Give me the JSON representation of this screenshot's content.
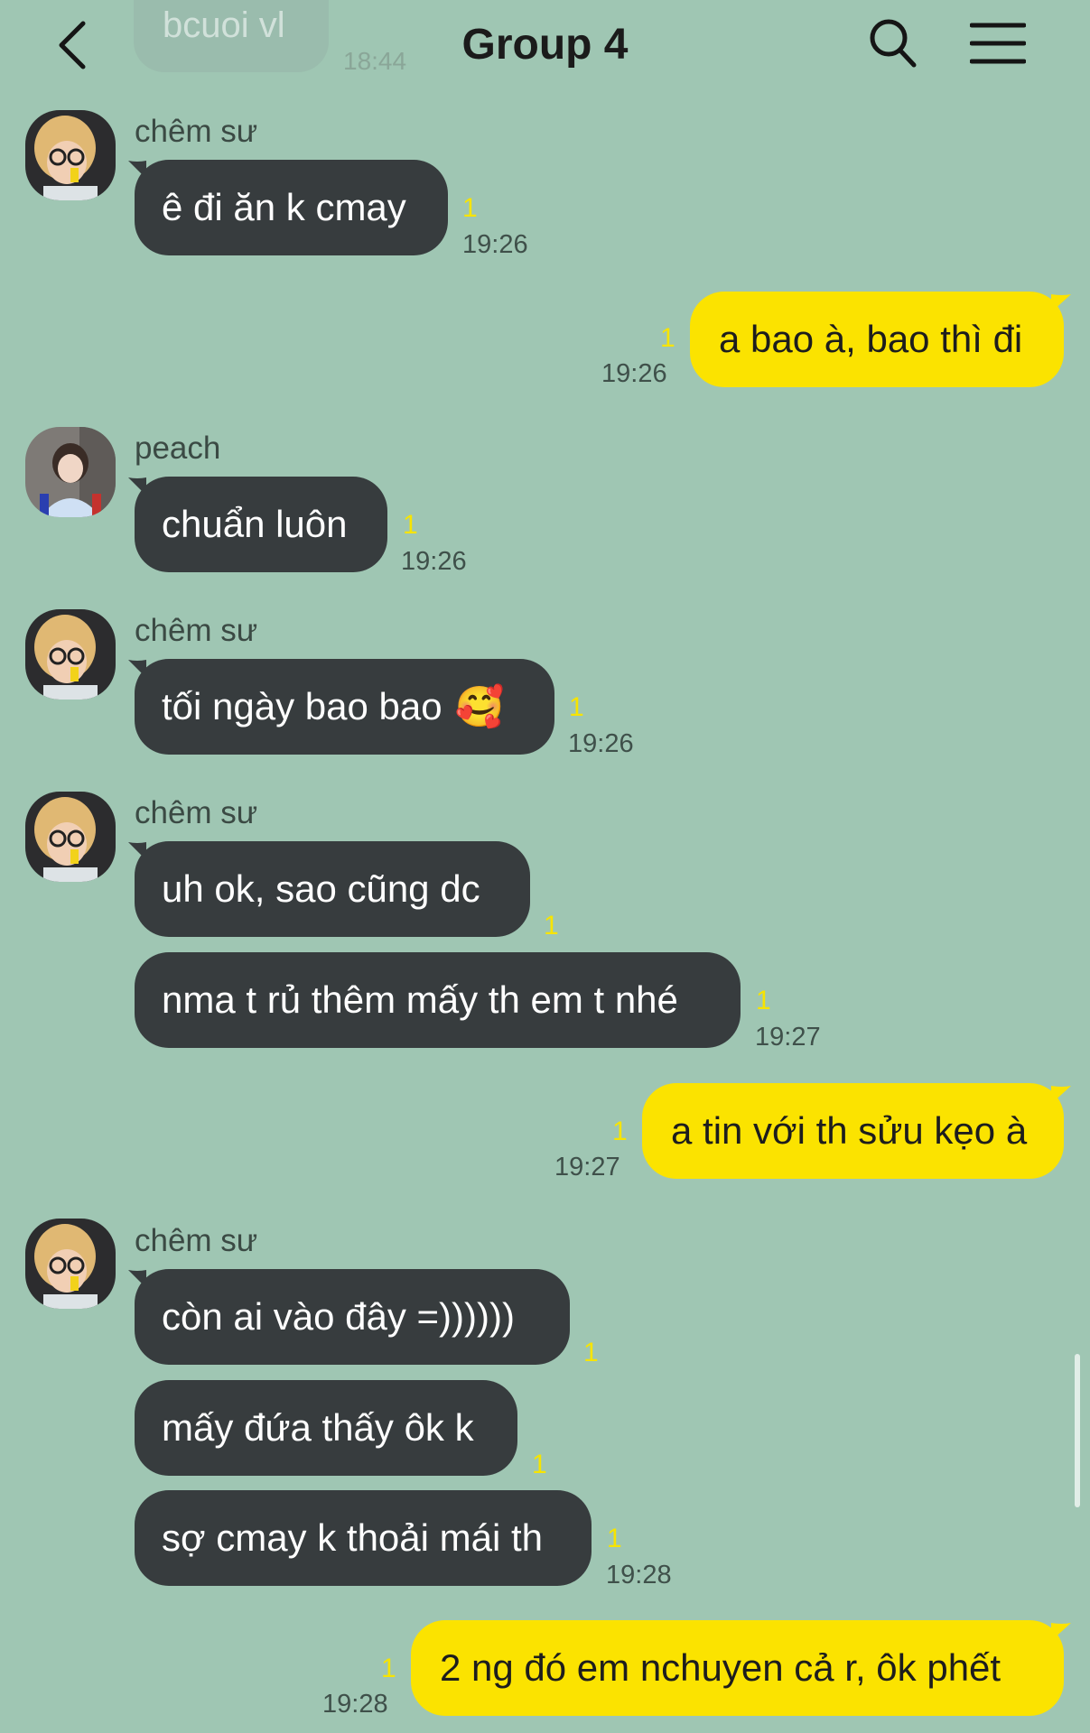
{
  "header": {
    "title": "Group 4",
    "back_icon": "chevron-left-icon",
    "search_icon": "search-icon",
    "menu_icon": "hamburger-menu-icon"
  },
  "previous_message": {
    "text": "bcuoi vl",
    "time": "18:44"
  },
  "messages": [
    {
      "sender": "chêm sư",
      "text": "ê đi ăn k cmay",
      "unread": "1",
      "time": "19:26"
    },
    {
      "text": "a bao à, bao thì đi",
      "unread": "1",
      "time": "19:26"
    },
    {
      "sender": "peach",
      "text": "chuẩn luôn",
      "unread": "1",
      "time": "19:26"
    },
    {
      "sender": "chêm sư",
      "text": "tối ngày bao bao",
      "emoji": "🥰",
      "unread": "1",
      "time": "19:26"
    },
    {
      "sender": "chêm sư",
      "text": "uh ok, sao cũng dc",
      "unread": "1"
    },
    {
      "text": "nma t rủ thêm mấy th em t nhé",
      "unread": "1",
      "time": "19:27"
    },
    {
      "text": "a tin với th sửu kẹo à",
      "unread": "1",
      "time": "19:27"
    },
    {
      "sender": "chêm sư",
      "text": "còn ai vào đây =))))))",
      "unread": "1"
    },
    {
      "text": "mấy đứa thấy ôk k",
      "unread": "1"
    },
    {
      "text": "sợ cmay k thoải mái th",
      "unread": "1",
      "time": "19:28"
    },
    {
      "text": "2 ng đó em nchuyen cả r, ôk phết",
      "unread": "1",
      "time": "19:28"
    }
  ],
  "colors": {
    "background": "#9fc6b3",
    "incoming_bubble": "#373c3e",
    "outgoing_bubble": "#fbe300",
    "unread_count": "#f7e400"
  }
}
